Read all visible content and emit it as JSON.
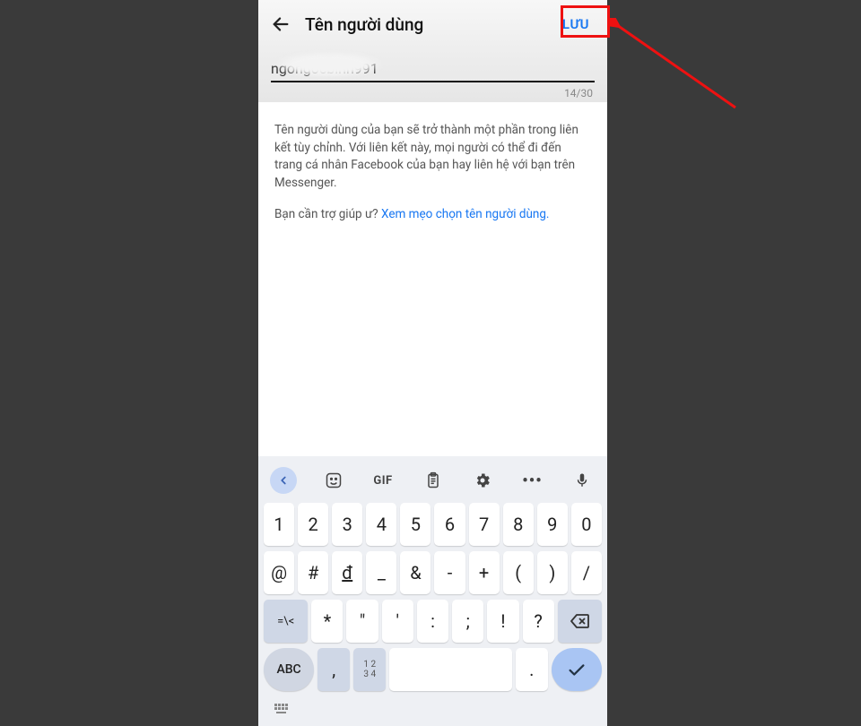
{
  "header": {
    "title": "Tên người dùng",
    "save": "LƯU"
  },
  "input": {
    "value": "ngongocbinh991",
    "counter": "14/30"
  },
  "description": "Tên người dùng của bạn sẽ trở thành một phần trong liên kết tùy chỉnh. Với liên kết này, mọi người có thể đi đến trang cá nhân Facebook của bạn hay liên hệ với bạn trên Messenger.",
  "help": {
    "prompt": "Bạn cần trợ giúp ư? ",
    "link": "Xem mẹo chọn tên người dùng."
  },
  "kb": {
    "toolbar": {
      "gif": "GIF",
      "dots": "•••"
    },
    "row1": [
      "1",
      "2",
      "3",
      "4",
      "5",
      "6",
      "7",
      "8",
      "9",
      "0"
    ],
    "row2": [
      "@",
      "#",
      "đ",
      "_",
      "&",
      "-",
      "+",
      "(",
      ")",
      "/"
    ],
    "row3": {
      "shift": "=\\<",
      "keys": [
        "*",
        "\"",
        "'",
        ":",
        ";",
        "!",
        "?"
      ],
      "back": "⌫"
    },
    "row4": {
      "abc": "ABC",
      "comma": ",",
      "multi": "1 2\n3 4",
      "space": "",
      "dot": ".",
      "enter": "✓"
    }
  }
}
